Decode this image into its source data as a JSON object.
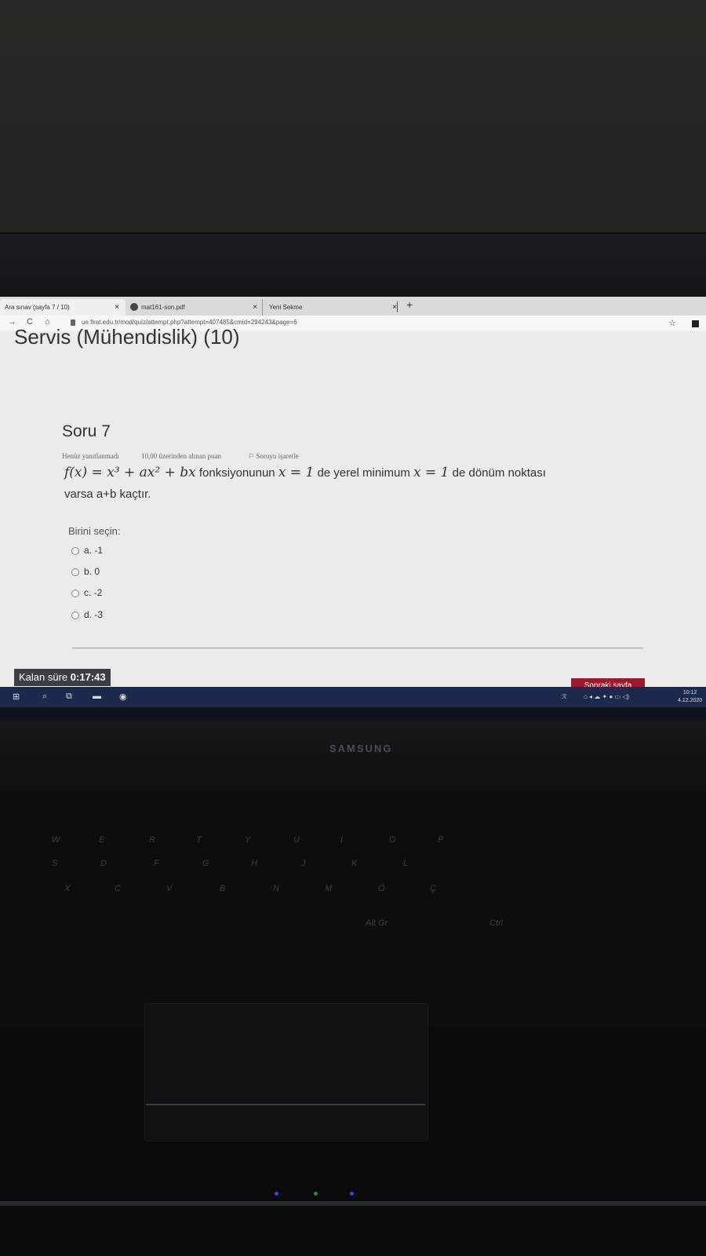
{
  "browser": {
    "tabs": [
      {
        "title": "Ara sınav (sayfa 7 / 10)"
      },
      {
        "title": "mat161-son.pdf"
      },
      {
        "title": "Yeni Sekme"
      }
    ],
    "url": "ue.firat.edu.tr/mod/quiz/attempt.php?attempt=407485&cmid=294243&page=6"
  },
  "course_title": "Servis (Mühendislik) (10)",
  "question": {
    "number_label": "Soru 7",
    "status": "Henüz yanıtlanmadı",
    "points": "10,00 üzerinden alınan puan",
    "flag_label": "Soruyu işaretle",
    "text_mid": "fonksiyonunun",
    "text_mid2": "de yerel minimum",
    "text_end": "de dönüm noktası",
    "text_line2": "varsa a+b kaçtır.",
    "prompt": "Birini seçin:",
    "options": [
      {
        "label": "a. -1"
      },
      {
        "label": "b. 0"
      },
      {
        "label": "c. -2"
      },
      {
        "label": "d. -3"
      }
    ]
  },
  "timer": {
    "label": "Kalan süre",
    "value": "0:17:43"
  },
  "next_button": "Sonraki sayfa",
  "taskbar": {
    "time": "10:12",
    "date": "4.12.2020"
  },
  "laptop_brand": "SAMSUNG",
  "icons": [
    "back-arrow-icon",
    "reload-icon",
    "home-icon",
    "lock-icon",
    "star-icon",
    "windows-start-icon",
    "search-icon",
    "task-view-icon",
    "file-explorer-icon",
    "chrome-icon"
  ]
}
